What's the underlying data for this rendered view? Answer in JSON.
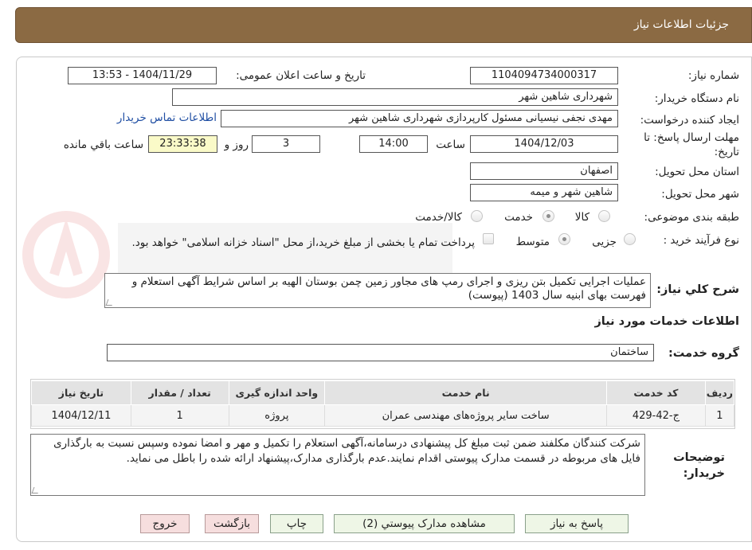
{
  "header": {
    "title": "جزئیات اطلاعات نیاز"
  },
  "fields": {
    "need_number_label": "شماره نیاز:",
    "need_number": "1104094734000317",
    "announce_label": "تاریخ و ساعت اعلان عمومی:",
    "announce_value": "1404/11/29 - 13:53",
    "buyer_org_label": "نام دستگاه خریدار:",
    "buyer_org": "شهرداری شاهین شهر",
    "requester_label": "ایجاد کننده درخواست:",
    "requester": "مهدی نجفی نیسیانی مسئول کارپردازی شهرداری شاهین شهر",
    "contact_link": "اطلاعات تماس خریدار",
    "deadline_label_1": "مهلت ارسال پاسخ: تا",
    "deadline_label_2": "تاریخ:",
    "deadline_date": "1404/12/03",
    "time_label": "ساعت",
    "deadline_time": "14:00",
    "days_value": "3",
    "days_label": "روز و",
    "remaining_time": "23:33:38",
    "remaining_label": "ساعت باقي مانده",
    "province_label": "استان محل تحویل:",
    "province": "اصفهان",
    "city_label": "شهر محل تحویل:",
    "city": "شاهین شهر و میمه",
    "category_label": "طبقه بندی موضوعی:",
    "category_options": [
      "کالا",
      "خدمت",
      "کالا/خدمت"
    ],
    "process_label": "نوع فرآیند خرید :",
    "process_options": [
      "جزیی",
      "متوسط"
    ],
    "payment_note": "پرداخت تمام یا بخشی از مبلغ خرید،از محل \"اسناد خزانه اسلامی\" خواهد بود."
  },
  "description": {
    "label": "شرح کلي نياز:",
    "text": "عملیات اجرایی تکمیل بتن ریزی و اجرای رمپ های مجاور زمین چمن بوستان الهیه بر اساس شرایط آگهی استعلام و فهرست بهای ابنیه سال 1403 (پیوست)"
  },
  "services": {
    "section_title": "اطلاعات خدمات مورد نیاز",
    "group_label": "گروه خدمت:",
    "group_value": "ساختمان",
    "columns": [
      "ردیف",
      "کد خدمت",
      "نام خدمت",
      "واحد اندازه گیری",
      "تعداد / مقدار",
      "تاریخ نیاز"
    ],
    "rows": [
      [
        "1",
        "ج-42-429",
        "ساخت سایر پروژه‌های مهندسی عمران",
        "پروژه",
        "1",
        "1404/12/11"
      ]
    ]
  },
  "buyer_notes": {
    "label_1": "توضیحات",
    "label_2": "خریدار:",
    "text": "شرکت کنندگان مکلفند ضمن ثبت مبلغ کل پیشنهادی درسامانه،آگهی استعلام را  تکمیل و مهر و امضا نموده وسپس نسبت به بارگذاری فایل های مربوطه در قسمت مدارک پیوستی اقدام نمایند.عدم بارگذاری مدارک،پیشنهاد ارائه شده را باطل می نماید."
  },
  "buttons": {
    "reply": "پاسخ به نیاز",
    "attachments": "مشاهده مدارک پیوستي (2)",
    "print": "چاپ",
    "back": "بازگشت",
    "exit": "خروج"
  },
  "colors": {
    "header_bg": "#8b6a43",
    "link": "#1f4ea3",
    "button_green": "#eef6e6",
    "button_pink": "#f6dede",
    "remaining_bg": "#fafac8"
  }
}
